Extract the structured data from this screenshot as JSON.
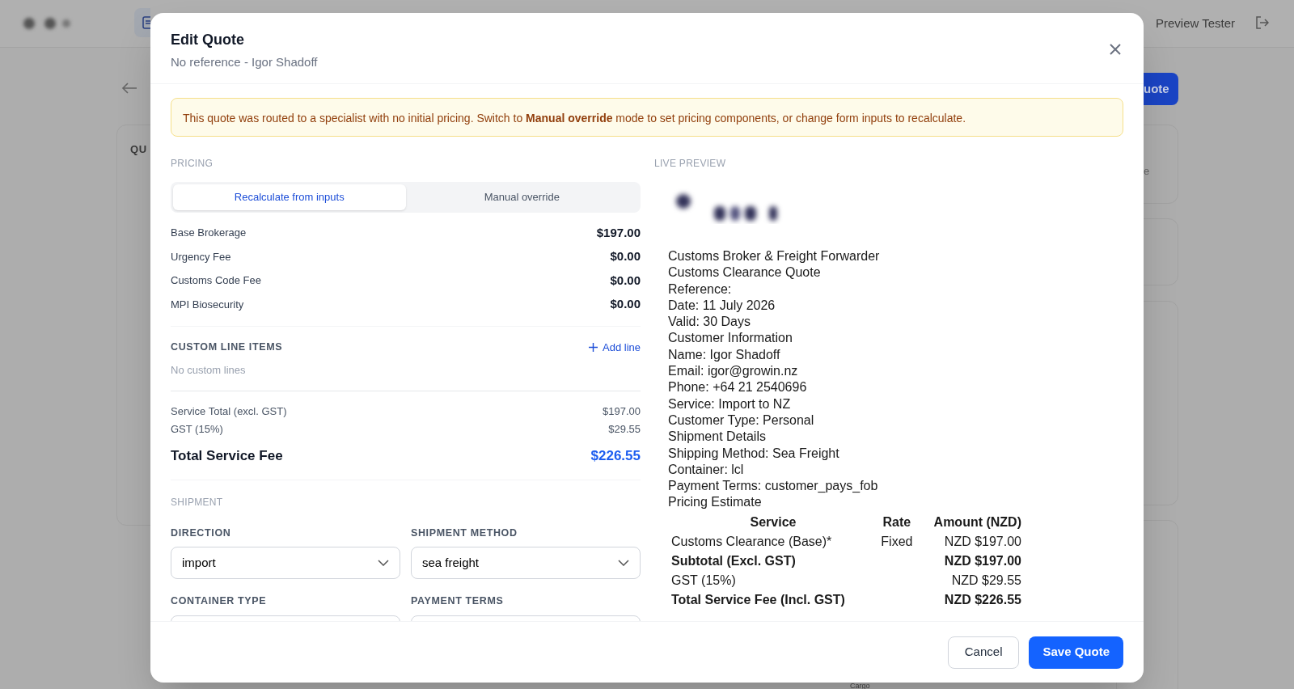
{
  "background": {
    "user_name": "Preview Tester",
    "header_button": "uote",
    "card_heading": "QU",
    "card_fragment": "e",
    "cargo_label": "Cargo"
  },
  "modal": {
    "title": "Edit Quote",
    "subtitle": "No reference - Igor Shadoff",
    "alert": "This quote was routed to a specialist with no initial pricing. Switch to **Manual override** mode to set pricing components, or change form inputs to recalculate.",
    "pricing": {
      "heading": "PRICING",
      "modes": [
        {
          "label": "Recalculate from inputs",
          "selected": true
        },
        {
          "label": "Manual override",
          "selected": false
        }
      ],
      "lines": [
        {
          "label": "Base Brokerage",
          "value": "$197.00"
        },
        {
          "label": "Urgency Fee",
          "value": "$0.00"
        },
        {
          "label": "Customs Code Fee",
          "value": "$0.00"
        },
        {
          "label": "MPI Biosecurity",
          "value": "$0.00"
        }
      ],
      "custom": {
        "heading": "CUSTOM LINE ITEMS",
        "add_label": "Add line",
        "empty": "No custom lines"
      },
      "totals": [
        {
          "label": "Service Total (excl. GST)",
          "value": "$197.00",
          "kind": "sub"
        },
        {
          "label": "GST (15%)",
          "value": "$29.55",
          "kind": "sub"
        },
        {
          "label": "Total Service Fee",
          "value": "$226.55",
          "kind": "grand"
        }
      ]
    },
    "shipment": {
      "heading": "SHIPMENT",
      "fields": [
        {
          "label": "DIRECTION",
          "value": "import"
        },
        {
          "label": "SHIPMENT METHOD",
          "value": "sea freight"
        },
        {
          "label": "CONTAINER TYPE"
        },
        {
          "label": "PAYMENT TERMS"
        }
      ]
    },
    "preview": {
      "heading": "LIVE PREVIEW",
      "lines": [
        "Customs Broker & Freight Forwarder",
        "Customs Clearance Quote",
        "Reference:",
        "Date: 11 July 2026",
        "Valid: 30 Days",
        "Customer Information",
        "Name: Igor Shadoff",
        "Email: igor@growin.nz",
        "Phone: +64 21 2540696",
        "Service: Import to NZ",
        "Customer Type: Personal",
        "Shipment Details",
        "Shipping Method: Sea Freight",
        "Container: lcl",
        "Payment Terms: customer_pays_fob",
        "Pricing Estimate"
      ],
      "table": {
        "columns": [
          "Service",
          "Rate",
          "Amount (NZD)"
        ],
        "rows": [
          {
            "cells": [
              "Customs Clearance (Base)*",
              "Fixed",
              "NZD $197.00"
            ],
            "bold": false
          },
          {
            "cells": [
              "Subtotal (Excl. GST)",
              "",
              "NZD $197.00"
            ],
            "bold": true
          },
          {
            "cells": [
              "GST (15%)",
              "",
              "NZD $29.55"
            ],
            "bold": false
          },
          {
            "cells": [
              "Total Service Fee (Incl. GST)",
              "",
              "NZD $226.55"
            ],
            "bold": true
          }
        ]
      }
    },
    "buttons": [
      {
        "label": "Cancel",
        "kind": "secondary"
      },
      {
        "label": "Save Quote",
        "kind": "primary"
      }
    ]
  }
}
